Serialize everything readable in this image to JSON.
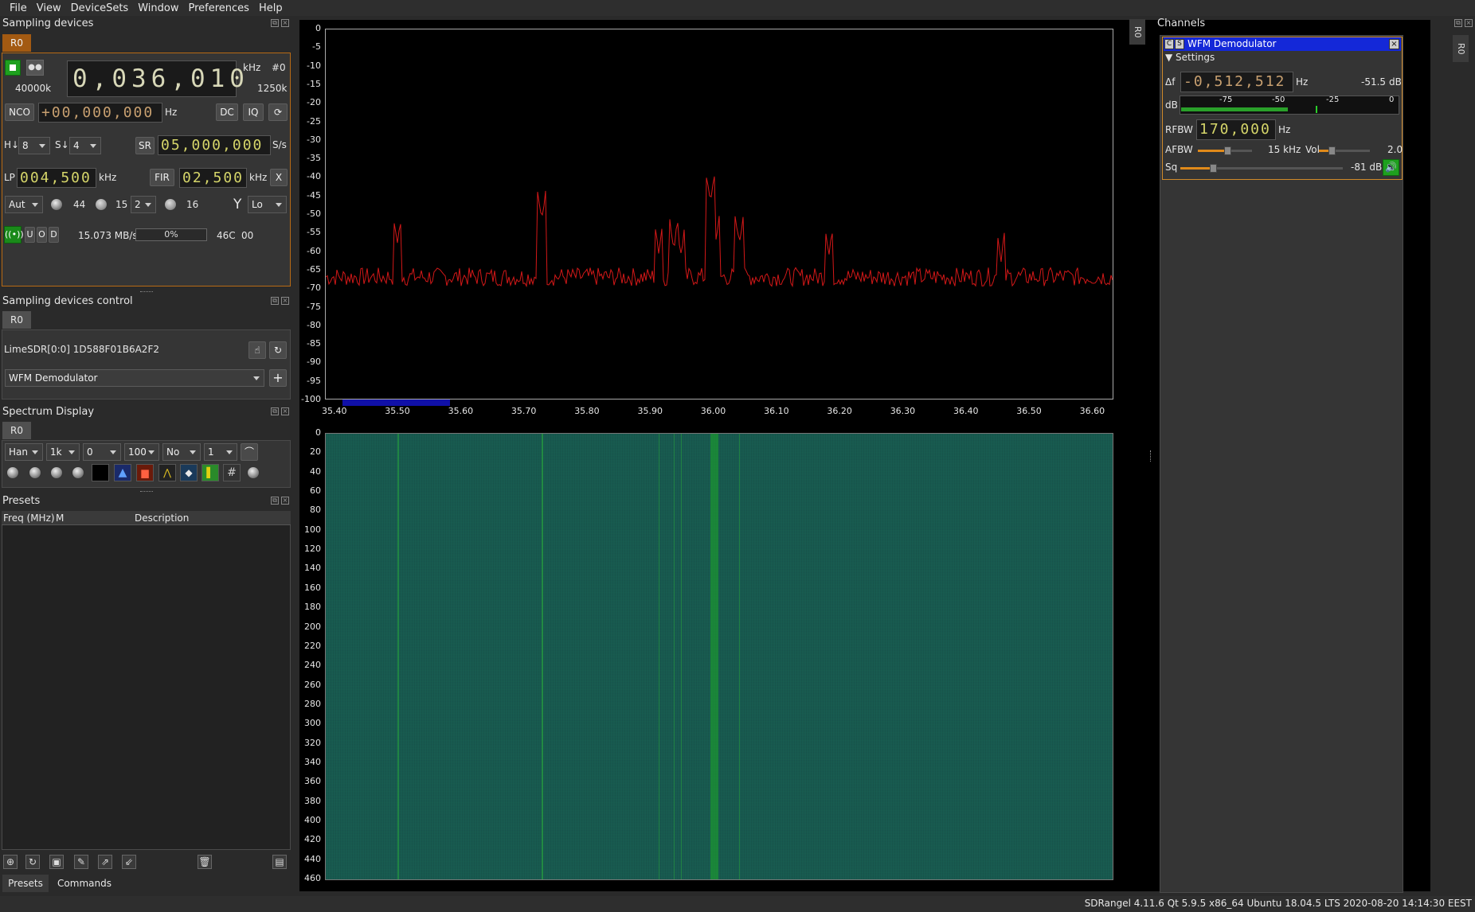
{
  "menu": [
    "File",
    "View",
    "DeviceSets",
    "Window",
    "Preferences",
    "Help"
  ],
  "sampling_devices": {
    "title": "Sampling devices",
    "tab": "R0",
    "frequency": "0,036,010",
    "freq_unit": "kHz",
    "device_index": "#0",
    "left_rate": "40000k",
    "right_rate": "1250k",
    "nco_label": "NCO",
    "nco_value": "+00,000,000",
    "nco_unit": "Hz",
    "dc_label": "DC",
    "iq_label": "IQ",
    "h_label": "H↓",
    "h_value": "8",
    "s_label": "S↓",
    "s_value": "4",
    "sr_label": "SR",
    "sr_value": "05,000,000",
    "sr_unit": "S/s",
    "lp_label": "LP",
    "lp_value": "004,500",
    "lp_unit": "kHz",
    "fir_label": "FIR",
    "fir_value": "02,500",
    "fir_unit": "kHz",
    "x_label": "X",
    "gain_mode": "Aut",
    "gain_value": "44",
    "lna_value": "15",
    "tia_value": "2",
    "pga_value": "16",
    "antenna": "Lo",
    "udp_u": "U",
    "udp_o": "O",
    "udp_d": "D",
    "stream_rate": "15.073 MB/s",
    "fifo_percent": "0%",
    "temperature": "46C",
    "gpio": "00"
  },
  "sampling_control": {
    "title": "Sampling devices control",
    "tab": "R0",
    "device_name": "LimeSDR[0:0] 1D588F01B6A2F2",
    "channel_select": "WFM Demodulator"
  },
  "spectrum_display": {
    "title": "Spectrum Display",
    "tab": "R0",
    "window": "Han",
    "fft_size": "1k",
    "ref_level": "0",
    "range": "100",
    "averaging": "No",
    "avg_count": "1"
  },
  "presets": {
    "title": "Presets",
    "col_freq": "Freq (MHz)",
    "col_mode": "M",
    "col_desc": "Description",
    "tab_presets": "Presets",
    "tab_commands": "Commands"
  },
  "spectrum": {
    "y_ticks": [
      "0",
      "-5",
      "-10",
      "-15",
      "-20",
      "-25",
      "-30",
      "-35",
      "-40",
      "-45",
      "-50",
      "-55",
      "-60",
      "-65",
      "-70",
      "-75",
      "-80",
      "-85",
      "-90",
      "-95",
      "-100"
    ],
    "x_ticks": [
      "35.40",
      "35.50",
      "35.60",
      "35.70",
      "35.80",
      "35.90",
      "36.00",
      "36.10",
      "36.20",
      "36.30",
      "36.40",
      "36.50",
      "36.60"
    ],
    "wf_ticks": [
      "0",
      "20",
      "40",
      "60",
      "80",
      "100",
      "120",
      "140",
      "160",
      "180",
      "200",
      "220",
      "240",
      "260",
      "280",
      "300",
      "320",
      "340",
      "360",
      "380",
      "400",
      "420",
      "440",
      "460"
    ],
    "line_color": "#d41818",
    "waterfall_color": "#18584f"
  },
  "channels": {
    "title": "Channels",
    "wfm_title": "WFM Demodulator",
    "settings_label": "Settings",
    "delta_f_label": "Δf",
    "delta_f_value": "-0,512,512",
    "delta_f_unit": "Hz",
    "power": "-51.5",
    "power_unit": "dB",
    "db_label": "dB",
    "meter_ticks": [
      "-75",
      "-50",
      "-25",
      "0"
    ],
    "rfbw_label": "RFBW",
    "rfbw_value": "170,000",
    "rfbw_unit": "Hz",
    "afbw_label": "AFBW",
    "afbw_value": "15 kHz",
    "vol_label": "Vol",
    "vol_value": "2.0",
    "sq_label": "Sq",
    "sq_value": "-81 dB",
    "afbw_level": 0.55,
    "vol_level": 0.25,
    "sq_level": 0.2
  },
  "side_tabs": {
    "left_r0": "R0",
    "right_r0": "R0"
  },
  "status_bar": "SDRangel 4.11.6 Qt 5.9.5 x86_64 Ubuntu 18.04.5 LTS  2020-08-20 14:14:30 EEST"
}
